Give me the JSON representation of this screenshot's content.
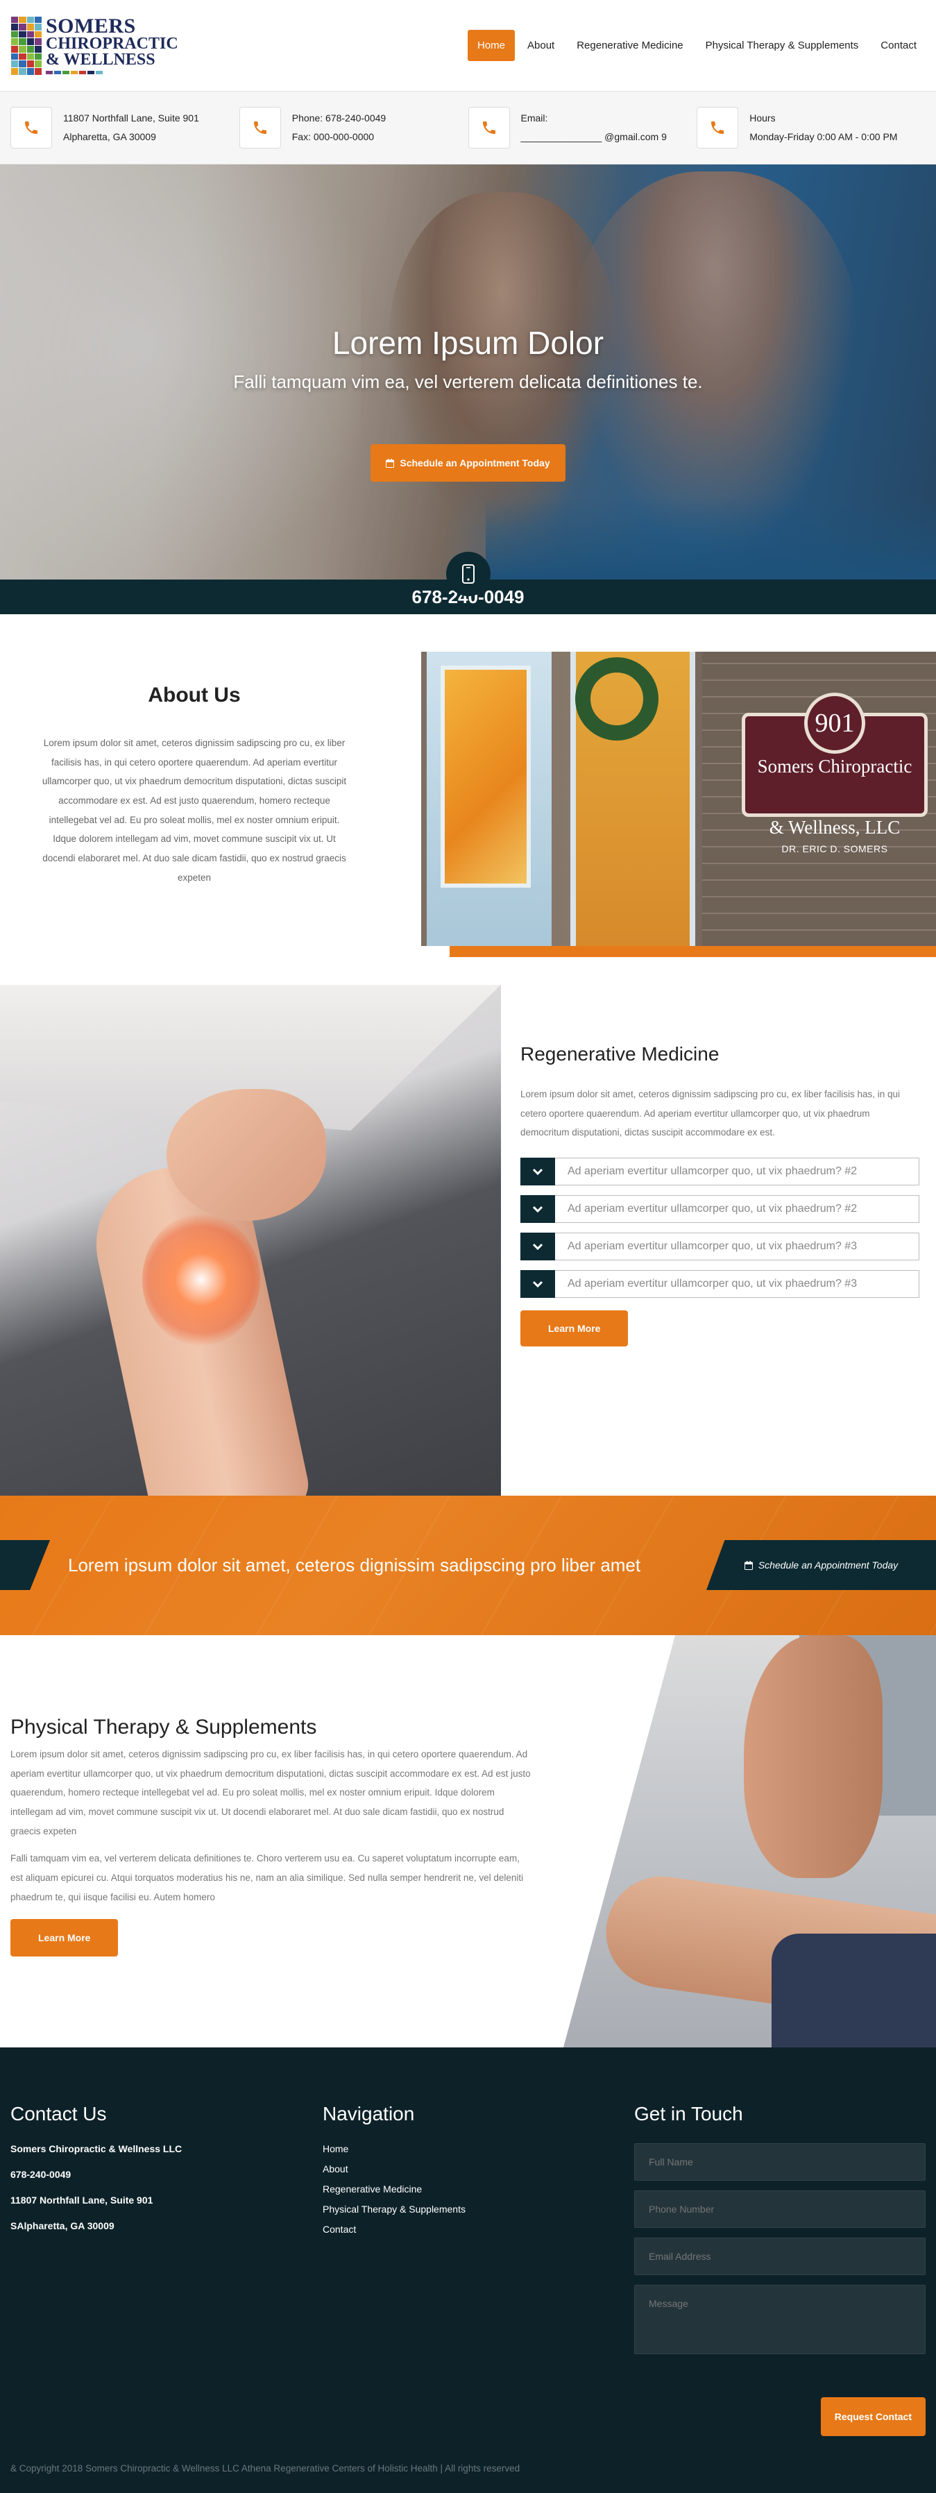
{
  "logo": {
    "line1": "SOMERS",
    "line2": "CHIROPRACTIC",
    "line3": "& WELLNESS",
    "colors": [
      "#7a3b7e",
      "#2f6bb3",
      "#4a9b3c",
      "#e7a225",
      "#c7372f",
      "#1e2a5a",
      "#6bb7c8",
      "#8cbf3f"
    ]
  },
  "nav": {
    "items": [
      "Home",
      "About",
      "Regenerative Medicine",
      "Physical Therapy & Supplements",
      "Contact"
    ],
    "active": "Home"
  },
  "infobar": {
    "address": {
      "line1": "11807 Northfall Lane, Suite 901",
      "line2": "Alpharetta, GA 30009",
      "icon": "phone-icon"
    },
    "phone": {
      "line1": "Phone: 678-240-0049",
      "line2": "Fax: 000-000-0000",
      "icon": "phone-icon"
    },
    "email": {
      "line1": "Email:",
      "line2": "_______________ @gmail.com 9",
      "icon": "phone-icon"
    },
    "hours": {
      "line1": "Hours",
      "line2": "Monday-Friday 0:00 AM - 0:00 PM",
      "icon": "phone-icon"
    }
  },
  "hero": {
    "title": "Lorem Ipsum Dolor",
    "subtitle": "Falli tamquam vim ea, vel verterem delicata definitiones te.",
    "button": "Schedule an Appointment Today",
    "phone": "678-240-0049"
  },
  "about": {
    "title": "About Us",
    "body": "Lorem ipsum dolor sit amet, ceteros dignissim sadipscing pro cu, ex liber facilisis has, in qui cetero oportere quaerendum. Ad aperiam evertitur ullamcorper quo, ut vix phaedrum democritum disputationi, dictas suscipit accommodare ex est. Ad est justo quaerendum, homero recteque intellegebat vel ad. Eu pro soleat mollis, mel ex noster omnium eripuit. Idque dolorem intellegam ad vim, movet commune suscipit vix ut. Ut docendi elaboraret mel. At duo sale dicam fastidii, quo ex nostrud graecis expeten",
    "sign": {
      "number": "901",
      "line1": "Somers Chiropractic",
      "line2": "& Wellness, LLC",
      "line3": "DR. ERIC D. SOMERS"
    }
  },
  "regen": {
    "title": "Regenerative Medicine",
    "body": "Lorem ipsum dolor sit amet, ceteros dignissim sadipscing pro cu, ex liber facilisis has, in qui cetero oportere quaerendum. Ad aperiam evertitur ullamcorper quo, ut vix phaedrum democritum disputationi, dictas suscipit accommodare ex est.",
    "accordion": [
      "Ad aperiam evertitur ullamcorper quo, ut vix phaedrum? #2",
      "Ad aperiam evertitur ullamcorper quo, ut vix phaedrum? #2",
      "Ad aperiam evertitur ullamcorper quo, ut vix phaedrum? #3",
      "Ad aperiam evertitur ullamcorper quo, ut vix phaedrum? #3"
    ],
    "button": "Learn More"
  },
  "cta": {
    "text": "Lorem ipsum dolor sit amet, ceteros dignissim sadipscing pro liber amet",
    "button": "Schedule an Appointment Today"
  },
  "pt": {
    "title": "Physical Therapy & Supplements",
    "body1": "Lorem ipsum dolor sit amet, ceteros dignissim sadipscing pro cu, ex liber facilisis has, in qui cetero oportere quaerendum. Ad aperiam evertitur ullamcorper quo, ut vix phaedrum democritum disputationi, dictas suscipit accommodare ex est. Ad est justo quaerendum, homero recteque intellegebat vel ad. Eu pro soleat mollis, mel ex noster omnium eripuit. Idque dolorem intellegam ad vim, movet commune suscipit vix ut. Ut docendi elaboraret mel. At duo sale dicam fastidii, quo ex nostrud graecis expeten",
    "body2": "Falli tamquam vim ea, vel verterem delicata definitiones te. Choro verterem usu ea. Cu saperet voluptatum incorrupte eam, est aliquam epicurei cu. Atqui torquatos moderatius his ne, nam an alia similique. Sed nulla semper hendrerit ne, vel deleniti phaedrum te, qui iisque facilisi eu. Autem homero",
    "button": "Learn More"
  },
  "footer": {
    "contact": {
      "title": "Contact Us",
      "lines": [
        "Somers Chiropractic & Wellness LLC",
        "678-240-0049",
        "11807 Northfall Lane, Suite 901",
        "SAlpharetta, GA 30009"
      ]
    },
    "navigation": {
      "title": "Navigation",
      "links": [
        "Home",
        "About",
        "Regenerative Medicine",
        "Physical Therapy & Supplements",
        "Contact"
      ]
    },
    "form": {
      "title": "Get in Touch",
      "name_placeholder": "Full Name",
      "phone_placeholder": "Phone Number",
      "email_placeholder": "Email Address",
      "message_placeholder": "Message",
      "submit": "Request Contact"
    },
    "copyright": "& Copyright 2018 Somers Chiropractic & Wellness LLC Athena Regenerative Centers of Holistic Health | All rights reserved"
  },
  "colors": {
    "accent": "#e77918",
    "dark": "#0d2a32",
    "footer": "#0d2228"
  }
}
